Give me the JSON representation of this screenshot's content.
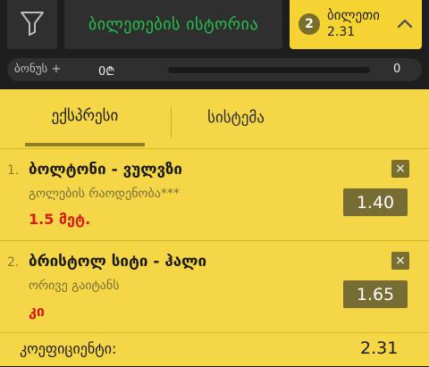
{
  "header": {
    "history_label": "ბილეთების ისტორია",
    "betslip": {
      "count": "2",
      "label": "ბილეთი",
      "odds": "2.31"
    }
  },
  "icons": {
    "filter": "filter-icon",
    "chevron": "chevron-up-icon",
    "remove": "close-icon"
  },
  "bonus": {
    "label": "ბონუს +",
    "amount": "0₾",
    "value": "0",
    "progress": 0
  },
  "tabs": [
    {
      "label": "ექსპრესი",
      "active": true
    },
    {
      "label": "სისტემა",
      "active": false
    }
  ],
  "bets": [
    {
      "num": "1.",
      "match": "ბოლტონი - ვულვზი",
      "market": "გოლების რაოდენობა***",
      "pick": "1.5 მეტ.",
      "odds": "1.40",
      "remove": "×"
    },
    {
      "num": "2.",
      "match": "ბრისტოლ სიტი - ჰალი",
      "market": "ორივე გაიტანს",
      "pick": "კი",
      "odds": "1.65",
      "remove": "×"
    }
  ],
  "total": {
    "label": "კოეფიციენტი:",
    "value": "2.31"
  },
  "colors": {
    "accent": "#f5d332",
    "panel": "#f5d646",
    "green": "#25c24a",
    "dark": "#1e1e1e",
    "red": "#d41a1a"
  }
}
